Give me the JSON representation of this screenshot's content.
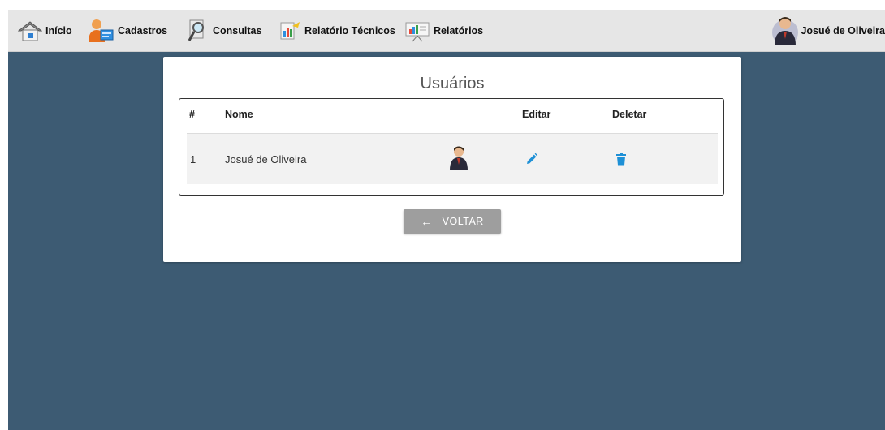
{
  "navbar": {
    "items": [
      {
        "label": "Início",
        "icon": "home-icon"
      },
      {
        "label": "Cadastros",
        "icon": "users-register-icon"
      },
      {
        "label": "Consultas",
        "icon": "search-magnifier-icon"
      },
      {
        "label": "Relatório Técnicos",
        "icon": "technical-report-icon"
      },
      {
        "label": "Relatórios",
        "icon": "reports-chart-icon"
      }
    ],
    "user": {
      "name": "Josué de Oliveira",
      "icon": "user-avatar-icon"
    }
  },
  "page": {
    "title": "Usuários",
    "back_label": "VOLTAR"
  },
  "table": {
    "headers": {
      "index": "#",
      "name": "Nome",
      "edit": "Editar",
      "delete": "Deletar"
    },
    "rows": [
      {
        "index": "1",
        "name": "Josué de Oliveira"
      }
    ]
  },
  "colors": {
    "background": "#3d5b73",
    "navbar": "#e6e6e6",
    "accent": "#1e90d6",
    "button": "#9e9e9e"
  }
}
